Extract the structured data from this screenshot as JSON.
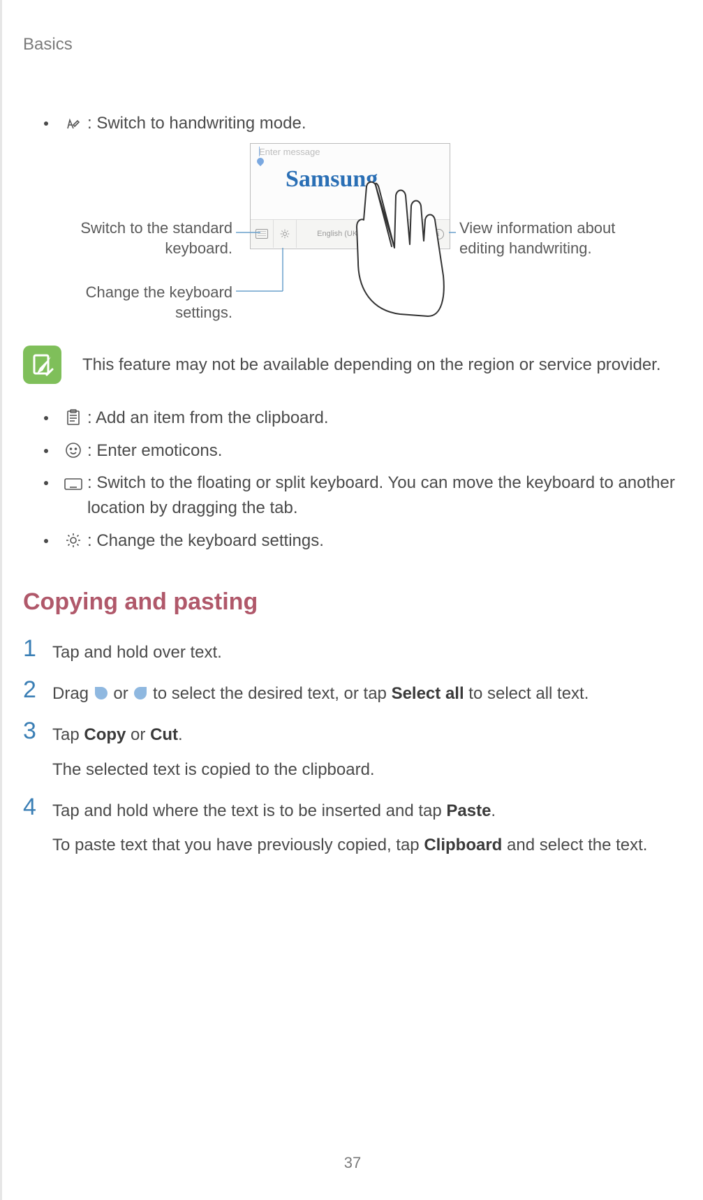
{
  "header": "Basics",
  "bullets": {
    "handwriting": ": Switch to handwriting mode.",
    "clipboard": ": Add an item from the clipboard.",
    "emoticons": ": Enter emoticons.",
    "floating": ": Switch to the floating or split keyboard. You can move the keyboard to another location by dragging the tab.",
    "settings": ": Change the keyboard settings."
  },
  "diagram": {
    "placeholder": "Enter message",
    "sample_text": "Samsung",
    "lang": "English (UK)",
    "callouts": {
      "standard_kb": "Switch to the standard keyboard.",
      "change_settings": "Change the keyboard settings.",
      "view_info": "View information about editing handwriting."
    }
  },
  "note": "This feature may not be available depending on the region or service provider.",
  "section": "Copying and pasting",
  "steps": {
    "s1": "Tap and hold over text.",
    "s2_a": "Drag ",
    "s2_b": " or ",
    "s2_c": " to select the desired text, or tap ",
    "s2_bold": "Select all",
    "s2_d": " to select all text.",
    "s3_a": "Tap ",
    "s3_copy": "Copy",
    "s3_or": " or ",
    "s3_cut": "Cut",
    "s3_dot": ".",
    "s3_sub": "The selected text is copied to the clipboard.",
    "s4_a": "Tap and hold where the text is to be inserted and tap ",
    "s4_paste": "Paste",
    "s4_dot": ".",
    "s4_sub_a": "To paste text that you have previously copied, tap ",
    "s4_clip": "Clipboard",
    "s4_sub_b": " and select the text."
  },
  "nums": {
    "n1": "1",
    "n2": "2",
    "n3": "3",
    "n4": "4"
  },
  "page_num": "37"
}
